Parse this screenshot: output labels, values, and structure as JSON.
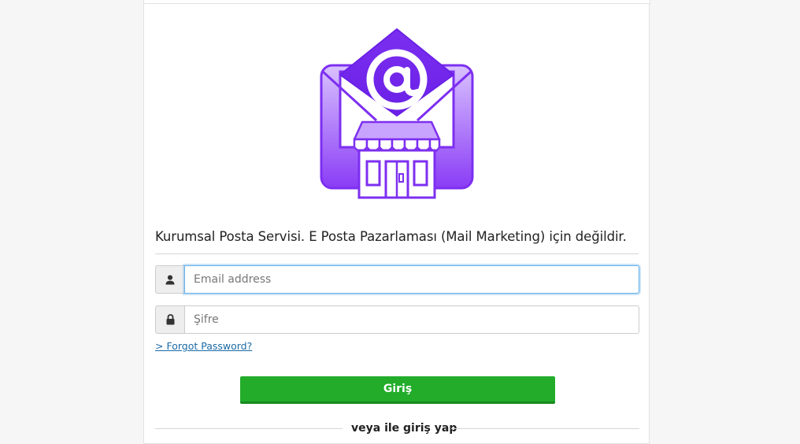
{
  "tagline": "Kurumsal Posta Servisi. E Posta Pazarlaması (Mail Marketing) için değildir.",
  "email": {
    "placeholder": "Email address",
    "value": "",
    "icon": "user-icon"
  },
  "password": {
    "placeholder": "Şifre",
    "value": "",
    "icon": "lock-icon"
  },
  "forgot_link": "> Forgot Password?",
  "login_button": "Giriş",
  "alt_login_divider": "veya ile giriş yap",
  "colors": {
    "logo_primary": "#7d2ff0",
    "logo_light": "#c9a4ff",
    "button": "#22ac2a",
    "link": "#1a6aa6",
    "focus_border": "#66afe9"
  }
}
